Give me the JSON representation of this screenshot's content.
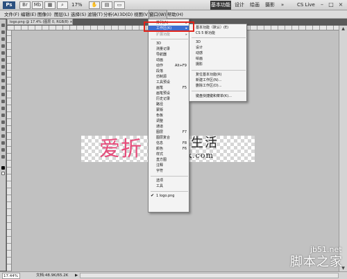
{
  "app": {
    "logo": "Ps",
    "zoom": "17%",
    "workspaces": [
      "基本功能",
      "设计",
      "绘画",
      "摄影"
    ],
    "active_workspace": "基本功能",
    "cs_live": "CS Live"
  },
  "menubar": {
    "items": [
      "文件(F)",
      "编辑(E)",
      "图像(I)",
      "图层(L)",
      "选择(S)",
      "滤镜(T)",
      "分析(A)",
      "3D(D)",
      "视图(V)",
      "窗口(W)",
      "帮助(H)"
    ],
    "open_item": "窗口(W)"
  },
  "document": {
    "tab": "logo.png @ 17.4% (图层 0, RGB/8) ×",
    "logo_pink": "爱折",
    "logo_dark": "生活",
    "logo_url": "ek.com"
  },
  "window_menu": {
    "items": [
      {
        "label": "排列(A)",
        "shortcut": "",
        "submenu": true
      },
      {
        "label": "工作区(K)",
        "shortcut": "",
        "submenu": true
      },
      {
        "label": "扩展功能",
        "shortcut": "",
        "submenu": true
      },
      {
        "label": "3D",
        "shortcut": ""
      },
      {
        "label": "测量记录",
        "shortcut": ""
      },
      {
        "label": "导航器",
        "shortcut": ""
      },
      {
        "label": "动画",
        "shortcut": ""
      },
      {
        "label": "动作",
        "shortcut": "Alt+F9"
      },
      {
        "label": "段落",
        "shortcut": ""
      },
      {
        "label": "仿制源",
        "shortcut": ""
      },
      {
        "label": "工具预设",
        "shortcut": ""
      },
      {
        "label": "画笔",
        "shortcut": "F5"
      },
      {
        "label": "画笔预设",
        "shortcut": ""
      },
      {
        "label": "历史记录",
        "shortcut": ""
      },
      {
        "label": "路径",
        "shortcut": ""
      },
      {
        "label": "蒙版",
        "shortcut": ""
      },
      {
        "label": "色板",
        "shortcut": ""
      },
      {
        "label": "调整",
        "shortcut": ""
      },
      {
        "label": "通道",
        "shortcut": ""
      },
      {
        "label": "图层",
        "shortcut": "F7"
      },
      {
        "label": "图层复合",
        "shortcut": ""
      },
      {
        "label": "信息",
        "shortcut": "F8"
      },
      {
        "label": "颜色",
        "shortcut": "F6"
      },
      {
        "label": "样式",
        "shortcut": ""
      },
      {
        "label": "直方图",
        "shortcut": ""
      },
      {
        "label": "注释",
        "shortcut": ""
      },
      {
        "label": "字符",
        "shortcut": ""
      },
      {
        "label": "选项",
        "shortcut": ""
      },
      {
        "label": "工具",
        "shortcut": ""
      },
      {
        "label": "1 logo.png",
        "shortcut": "",
        "checked": true
      }
    ],
    "highlighted": "工作区(K)"
  },
  "workspace_submenu": {
    "items": [
      "基本功能（默认）(E)",
      "CS 5 新功能",
      "3D",
      "设计",
      "动感",
      "绘画",
      "摄影",
      "复位基本功能(R)",
      "新建工作区(N)...",
      "删除工作区(D)...",
      "键盘快捷键和菜单(K)..."
    ]
  },
  "statusbar": {
    "zoom": "17.44%",
    "doc_info": "文档:48.9K/65.2K",
    "arrow": "▶"
  },
  "watermark": {
    "top": "jb51.net",
    "bottom": "脚本之家"
  },
  "colors": {
    "menu_highlight": "#3d6fd1",
    "annotation": "#e2231a",
    "logo_pink": "#e64b7a"
  }
}
